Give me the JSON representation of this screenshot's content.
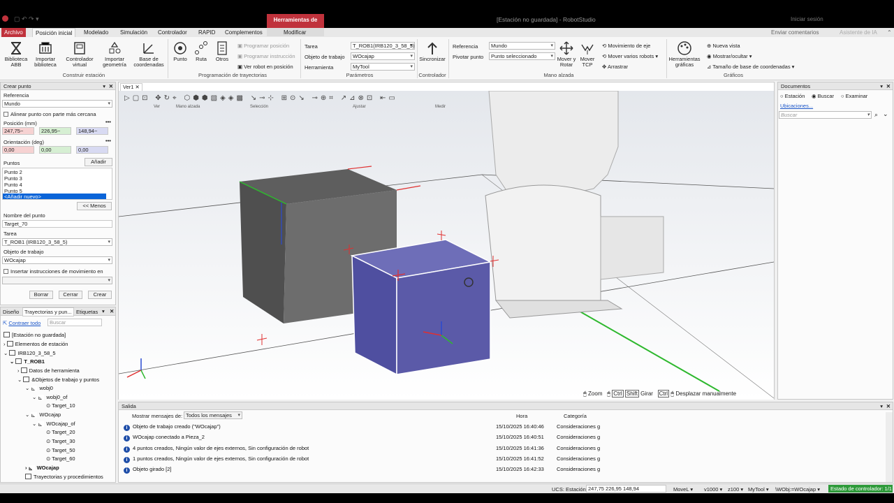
{
  "window": {
    "title": "[Estación no guardada] - RobotStudio",
    "signin": "Iniciar sesión",
    "context_band": "Herramientas de piezas",
    "context_tab": "Modificar",
    "feedback": "Enviar comentarios",
    "assistant": "Asistente de IA"
  },
  "tabs": [
    "Archivo",
    "Posición inicial",
    "Modelado",
    "Simulación",
    "Controlador",
    "RAPID",
    "Complementos"
  ],
  "ribbon": {
    "bib_abb": "Biblioteca ABB",
    "imp_bib": "Importar biblioteca",
    "ctrl_virtual": "Controlador virtual",
    "imp_geo": "Importar geometría",
    "base_coord": "Base de coordenadas",
    "punto": "Punto",
    "ruta": "Ruta",
    "otros": "Otros",
    "prog_pos": "Programar posición",
    "prog_instr": "Programar instrucción",
    "ver_robot": "Ver robot en posición",
    "tarea_lbl": "Tarea",
    "tarea_val": "T_ROB1(IRB120_3_58_5)",
    "obj_lbl": "Objeto de trabajo",
    "obj_val": "WOcajap",
    "herr_lbl": "Herramienta",
    "herr_val": "MyTool",
    "sincronizar": "Sincronizar",
    "ref_lbl": "Referencia",
    "ref_val": "Mundo",
    "piv_lbl": "Pivotar punto",
    "piv_val": "Punto seleccionado",
    "mover_rotar": "Mover y Rotar",
    "mover_tcp": "Mover TCP",
    "mov_eje": "Movimiento de eje",
    "mov_varios": "Mover varios robots",
    "arrastrar": "Arrastrar",
    "herr_graf": "Herramientas gráficas",
    "nueva_vista": "Nueva vista",
    "mostrar": "Mostrar/ocultar",
    "tam_base": "Tamaño de base de coordenadas",
    "g_construir": "Construir estación",
    "g_prog": "Programación de trayectorias",
    "g_param": "Parámetros",
    "g_ctrl": "Controlador",
    "g_mano": "Mano alzada",
    "g_graf": "Gráficos"
  },
  "crear": {
    "title": "Crear punto",
    "ref_lbl": "Referencia",
    "ref_val": "Mundo",
    "alinear": "Alinear punto con parte más cercana",
    "pos_lbl": "Posición (mm)",
    "px": "247,75~",
    "py": "226,95~",
    "pz": "148,94~",
    "ori_lbl": "Orientación (deg)",
    "ox": "0,00",
    "oy": "0,00",
    "oz": "0,00",
    "puntos_lbl": "Puntos",
    "anadir": "Añadir",
    "puntos": [
      "Punto 2",
      "Punto 3",
      "Punto 4",
      "Punto 5",
      "<Añadir nuevo>"
    ],
    "menos": "<< Menos",
    "nombre_lbl": "Nombre del punto",
    "nombre_val": "Target_70",
    "tarea_lbl": "Tarea",
    "tarea_val": "T_ROB1 (IRB120_3_58_5)",
    "obj_lbl": "Objeto de trabajo",
    "obj_val": "WOcajap",
    "insertar": "Insertar instrucciones de movimiento en",
    "borrar": "Borrar",
    "cerrar": "Cerrar",
    "crear": "Crear"
  },
  "browser": {
    "tabs": [
      "Diseño",
      "Trayectorias y pun...",
      "Etiquetas"
    ],
    "contraer": "Contraer todo",
    "buscar": "Buscar",
    "items": [
      "[Estación no guardada]",
      "Elementos de estación",
      "IRB120_3_58_5",
      "T_ROB1",
      "Datos de herramienta",
      "&Objetos de trabajo y puntos",
      "wobj0",
      "wobj0_of",
      "Target_10",
      "WOcajap",
      "WOcajap_of",
      "Target_20",
      "Target_30",
      "Target_50",
      "Target_60",
      "WOcajap",
      "Trayectorias y procedimientos"
    ]
  },
  "view": {
    "tab": "Ver1",
    "groups": [
      "Ver",
      "Mano alzada",
      "Selección",
      "Ajustar",
      "Medir"
    ],
    "zoom": "Zoom",
    "girar": "Girar",
    "desplazar": "Desplazar manualmente",
    "key_ctrl": "Ctrl",
    "key_shift": "Shift"
  },
  "docs": {
    "title": "Documentos",
    "estacion": "Estación",
    "buscar": "Buscar",
    "examinar": "Examinar",
    "ubicaciones": "Ubicaciones...",
    "placeholder": "Buscar"
  },
  "output": {
    "title": "Salida",
    "filter_lbl": "Mostrar mensajes de:",
    "filter_val": "Todos los mensajes",
    "col_hora": "Hora",
    "col_cat": "Categoría",
    "rows": [
      {
        "text": "Objeto de trabajo creado (\"WOcajap\")",
        "time": "15/10/2025 16:40:46",
        "cat": "Consideraciones g"
      },
      {
        "text": "WOcajap conectado a Pieza_2",
        "time": "15/10/2025 16:40:51",
        "cat": "Consideraciones g"
      },
      {
        "text": "4 puntos creados, Ningún valor de ejes externos, Sin configuración de robot",
        "time": "15/10/2025 16:41:36",
        "cat": "Consideraciones g"
      },
      {
        "text": "1 puntos creados, Ningún valor de ejes externos, Sin configuración de robot",
        "time": "15/10/2025 16:41:52",
        "cat": "Consideraciones g"
      },
      {
        "text": "Objeto girado [2]",
        "time": "15/10/2025 16:42:33",
        "cat": "Consideraciones g"
      }
    ]
  },
  "status": {
    "ucs_lbl": "UCS: Estación",
    "ucs_val": "247,75  226,95  148,94",
    "movel": "MoveL",
    "v": "v1000",
    "z": "z100",
    "tool": "MyTool",
    "wobj": "\\WObj:=WOcajap",
    "ctrl_state": "Estado de controlador: 1/1"
  },
  "colors": {
    "accent": "#c0323c",
    "selected_box": "#5b5aa8",
    "status_green": "#2e9a3a"
  }
}
